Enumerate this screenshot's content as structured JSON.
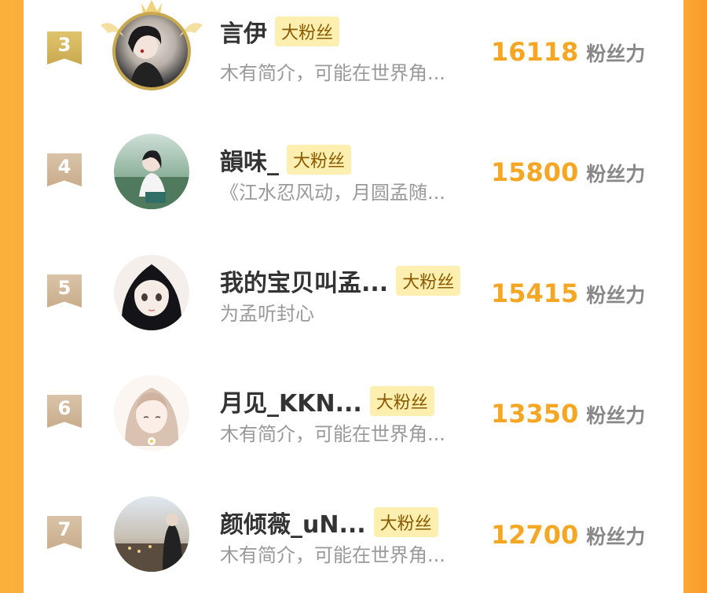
{
  "list": {
    "items": [
      {
        "rank": "3",
        "name": "言伊",
        "badge": "大粉丝",
        "bio": "木有简介，可能在世界角...",
        "score": "16118",
        "unit": "粉丝力"
      },
      {
        "rank": "4",
        "name": "韻味_",
        "badge": "大粉丝",
        "bio": "《江水忍风动，月圆孟随...",
        "score": "15800",
        "unit": "粉丝力"
      },
      {
        "rank": "5",
        "name": "我的宝贝叫孟...",
        "badge": "大粉丝",
        "bio": "为孟听封心",
        "score": "15415",
        "unit": "粉丝力"
      },
      {
        "rank": "6",
        "name": "月见_KKN...",
        "badge": "大粉丝",
        "bio": "木有简介，可能在世界角...",
        "score": "13350",
        "unit": "粉丝力"
      },
      {
        "rank": "7",
        "name": "颜倾薇_uN...",
        "badge": "大粉丝",
        "bio": "木有简介，可能在世界角...",
        "score": "12700",
        "unit": "粉丝力"
      }
    ]
  },
  "colors": {
    "accent": "#f5a623",
    "badge_bg": "#fdefb0",
    "rank_gold": "#c9a94f",
    "rank_tan": "#c9ad8c"
  }
}
